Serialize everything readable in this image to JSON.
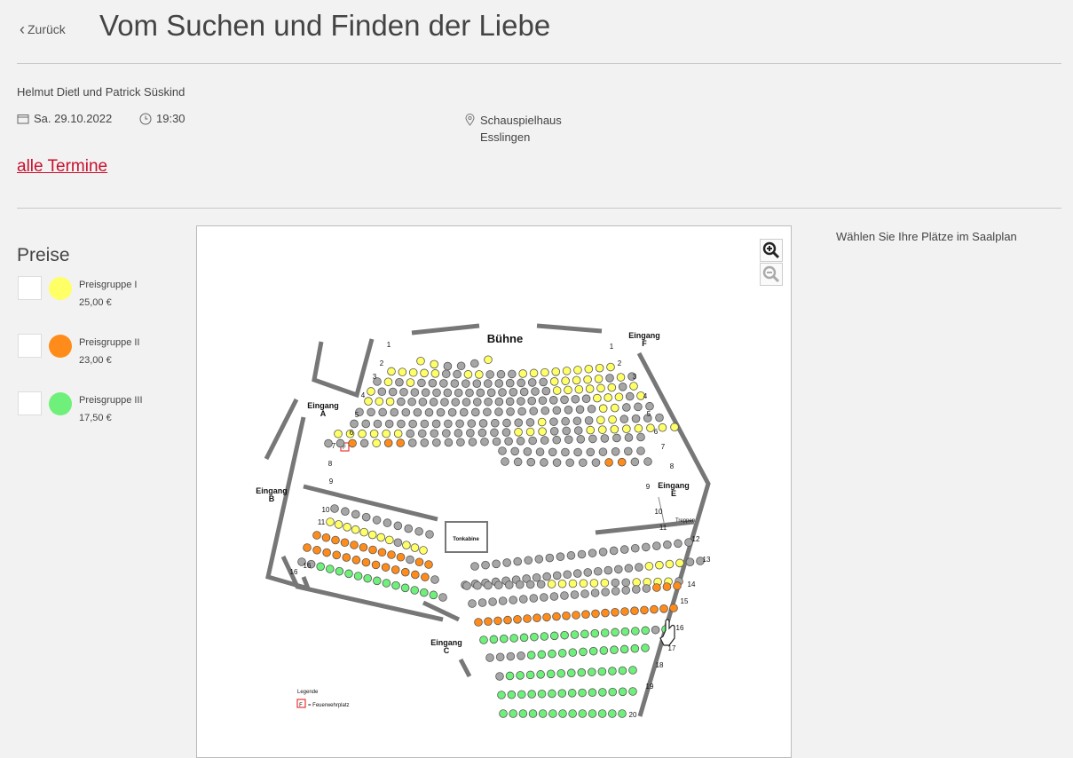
{
  "header": {
    "back_label": "Zurück",
    "title": "Vom Suchen und Finden der Liebe"
  },
  "event": {
    "authors": "Helmut Dietl und Patrick Süskind",
    "date": "Sa. 29.10.2022",
    "time": "19:30",
    "venue_line1": "Schauspielhaus",
    "venue_line2": "Esslingen",
    "all_dates_link": "alle Termine"
  },
  "prices": {
    "heading": "Preise",
    "groups": [
      {
        "name": "Preisgruppe I",
        "price": "25,00 €",
        "color": "#ffff66"
      },
      {
        "name": "Preisgruppe II",
        "price": "23,00 €",
        "color": "#ff8c1a"
      },
      {
        "name": "Preisgruppe III",
        "price": "17,50 €",
        "color": "#6ef07a"
      }
    ]
  },
  "seat_plan": {
    "stage_label": "Bühne",
    "control_booth_label": "Tonkabine",
    "stairs_label": "Treppen",
    "entrances": {
      "a": [
        "Eingang",
        "A"
      ],
      "b": [
        "Eingang",
        "B"
      ],
      "c": [
        "Eingang",
        "C"
      ],
      "e": [
        "Eingang",
        "E"
      ],
      "f": [
        "Eingang",
        "F"
      ]
    },
    "row_numbers": [
      "1",
      "2",
      "3",
      "4",
      "5",
      "6",
      "7",
      "8",
      "9",
      "10",
      "11",
      "12",
      "13",
      "14",
      "15",
      "16",
      "17",
      "18",
      "19",
      "20"
    ],
    "legend_title": "Legende",
    "legend_item": "= Feuerwehrplatz",
    "legend_mark": "F",
    "seat_colors": {
      "unavailable": "#a6a6a6",
      "group_1": "#ffff66",
      "group_2": "#ff8c1a",
      "group_3": "#6ef07a"
    }
  },
  "hint": "Wählen Sie Ihre Plätze im Saalplan"
}
